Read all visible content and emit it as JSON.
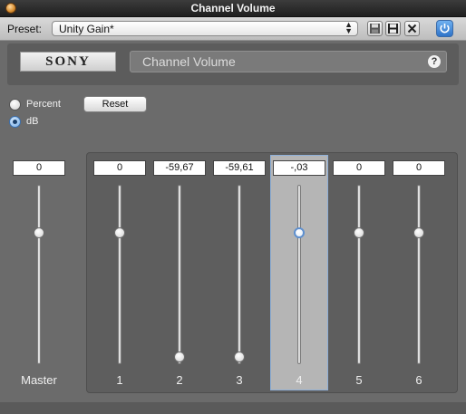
{
  "window": {
    "title": "Channel Volume"
  },
  "preset": {
    "label": "Preset:",
    "value": "Unity Gain*"
  },
  "toolbar": {
    "icons": [
      "save-icon",
      "save-as-icon",
      "delete-icon",
      "power-icon"
    ]
  },
  "plugin": {
    "brand": "SONY",
    "name": "Channel Volume",
    "help_icon": "?"
  },
  "units": {
    "options": [
      {
        "label": "Percent",
        "selected": false
      },
      {
        "label": "dB",
        "selected": true
      }
    ]
  },
  "reset_label": "Reset",
  "master": {
    "label": "Master",
    "value": "0",
    "level": 0.72
  },
  "channels": [
    {
      "label": "1",
      "value": "0",
      "level": 0.72
    },
    {
      "label": "2",
      "value": "-59,67",
      "level": 0.0
    },
    {
      "label": "3",
      "value": "-59,61",
      "level": 0.0
    },
    {
      "label": "4",
      "value": "-,03",
      "level": 0.72,
      "active": true
    },
    {
      "label": "5",
      "value": "0",
      "level": 0.72
    },
    {
      "label": "6",
      "value": "0",
      "level": 0.72
    }
  ],
  "colors": {
    "accent": "#5d8fcf",
    "power": "#2f73c8"
  }
}
